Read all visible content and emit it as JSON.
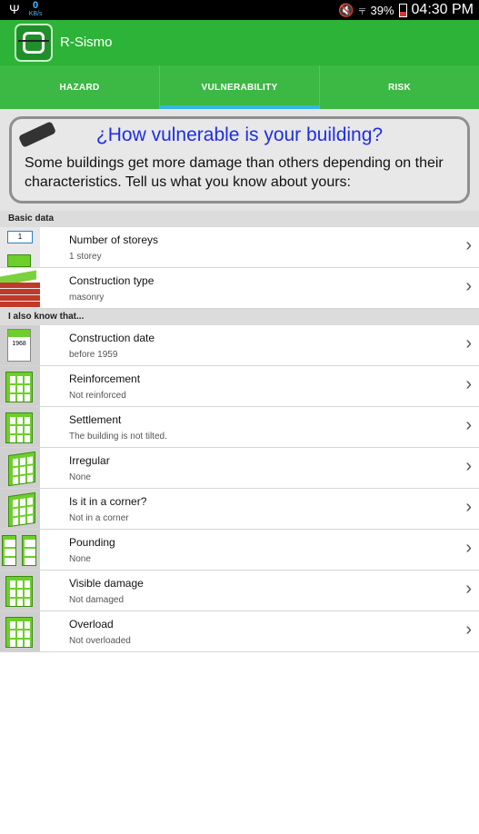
{
  "status": {
    "usb": "Ψ",
    "kb_num": "0",
    "kb_unit": "KB/s",
    "battery_pct": "39%",
    "time": "04:30 PM"
  },
  "app": {
    "title": "R-Sismo"
  },
  "tabs": [
    {
      "label": "HAZARD",
      "active": false
    },
    {
      "label": "VULNERABILITY",
      "active": true
    },
    {
      "label": "RISK",
      "active": false
    }
  ],
  "banner": {
    "question": "¿How vulnerable is your building?",
    "description": "Some buildings get more damage than others depending on their characteristics. Tell us what you know about yours:"
  },
  "sections": {
    "basic": "Basic data",
    "also": "I also know that..."
  },
  "basic_rows": [
    {
      "title": "Number of storeys",
      "value": "1 storey",
      "icon": "storeys-icon",
      "sign": "1"
    },
    {
      "title": "Construction type",
      "value": "masonry",
      "icon": "brick-wall-icon"
    }
  ],
  "also_rows": [
    {
      "title": "Construction date",
      "value": "before 1959",
      "icon": "calendar-icon",
      "year": "1968"
    },
    {
      "title": "Reinforcement",
      "value": "Not reinforced",
      "icon": "building-icon"
    },
    {
      "title": "Settlement",
      "value": "The building is not tilted.",
      "icon": "building-icon"
    },
    {
      "title": "Irregular",
      "value": "None",
      "icon": "irregular-building-icon"
    },
    {
      "title": "Is it in a corner?",
      "value": "Not in a corner",
      "icon": "corner-building-icon"
    },
    {
      "title": "Pounding",
      "value": "None",
      "icon": "pounding-buildings-icon"
    },
    {
      "title": "Visible damage",
      "value": "Not damaged",
      "icon": "building-icon"
    },
    {
      "title": "Overload",
      "value": "Not overloaded",
      "icon": "building-icon"
    }
  ],
  "chevron": "›",
  "colors": {
    "appbar": "#2db337",
    "tab_indicator": "#33b5e5",
    "question": "#1d2ee8"
  }
}
